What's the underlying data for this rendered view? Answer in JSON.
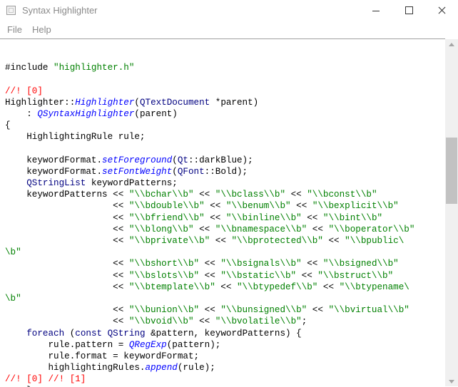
{
  "window": {
    "title": "Syntax Highlighter",
    "colors": {
      "keyword": "#000080",
      "class": "#000080",
      "string": "#008000",
      "function": "#0000ff",
      "comment": "#ff0000"
    }
  },
  "menu": {
    "file": "File",
    "help": "Help"
  },
  "code": {
    "lines": [
      [],
      [
        {
          "t": "#include ",
          "c": ""
        },
        {
          "t": "\"highlighter.h\"",
          "c": "str"
        }
      ],
      [],
      [
        {
          "t": "//! [0]",
          "c": "cmt"
        }
      ],
      [
        {
          "t": "Highlighter::",
          "c": ""
        },
        {
          "t": "Highlighter",
          "c": "fn"
        },
        {
          "t": "(",
          "c": ""
        },
        {
          "t": "QTextDocument",
          "c": "cls"
        },
        {
          "t": " *parent)",
          "c": ""
        }
      ],
      [
        {
          "t": "    : ",
          "c": ""
        },
        {
          "t": "QSyntaxHighlighter",
          "c": "fn"
        },
        {
          "t": "(parent)",
          "c": ""
        }
      ],
      [
        {
          "t": "{",
          "c": ""
        }
      ],
      [
        {
          "t": "    HighlightingRule rule;",
          "c": ""
        }
      ],
      [],
      [
        {
          "t": "    keywordFormat.",
          "c": ""
        },
        {
          "t": "setForeground",
          "c": "fn"
        },
        {
          "t": "(",
          "c": ""
        },
        {
          "t": "Qt",
          "c": "cls"
        },
        {
          "t": "::darkBlue);",
          "c": ""
        }
      ],
      [
        {
          "t": "    keywordFormat.",
          "c": ""
        },
        {
          "t": "setFontWeight",
          "c": "fn"
        },
        {
          "t": "(",
          "c": ""
        },
        {
          "t": "QFont",
          "c": "cls"
        },
        {
          "t": "::Bold);",
          "c": ""
        }
      ],
      [
        {
          "t": "    ",
          "c": ""
        },
        {
          "t": "QStringList",
          "c": "cls"
        },
        {
          "t": " keywordPatterns;",
          "c": ""
        }
      ],
      [
        {
          "t": "    keywordPatterns << ",
          "c": ""
        },
        {
          "t": "\"\\\\bchar\\\\b\"",
          "c": "str"
        },
        {
          "t": " << ",
          "c": ""
        },
        {
          "t": "\"\\\\bclass\\\\b\"",
          "c": "str"
        },
        {
          "t": " << ",
          "c": ""
        },
        {
          "t": "\"\\\\bconst\\\\b\"",
          "c": "str"
        }
      ],
      [
        {
          "t": "                    << ",
          "c": ""
        },
        {
          "t": "\"\\\\bdouble\\\\b\"",
          "c": "str"
        },
        {
          "t": " << ",
          "c": ""
        },
        {
          "t": "\"\\\\benum\\\\b\"",
          "c": "str"
        },
        {
          "t": " << ",
          "c": ""
        },
        {
          "t": "\"\\\\bexplicit\\\\b\"",
          "c": "str"
        }
      ],
      [
        {
          "t": "                    << ",
          "c": ""
        },
        {
          "t": "\"\\\\bfriend\\\\b\"",
          "c": "str"
        },
        {
          "t": " << ",
          "c": ""
        },
        {
          "t": "\"\\\\binline\\\\b\"",
          "c": "str"
        },
        {
          "t": " << ",
          "c": ""
        },
        {
          "t": "\"\\\\bint\\\\b\"",
          "c": "str"
        }
      ],
      [
        {
          "t": "                    << ",
          "c": ""
        },
        {
          "t": "\"\\\\blong\\\\b\"",
          "c": "str"
        },
        {
          "t": " << ",
          "c": ""
        },
        {
          "t": "\"\\\\bnamespace\\\\b\"",
          "c": "str"
        },
        {
          "t": " << ",
          "c": ""
        },
        {
          "t": "\"\\\\boperator\\\\b\"",
          "c": "str"
        }
      ],
      [
        {
          "t": "                    << ",
          "c": ""
        },
        {
          "t": "\"\\\\bprivate\\\\b\"",
          "c": "str"
        },
        {
          "t": " << ",
          "c": ""
        },
        {
          "t": "\"\\\\bprotected\\\\b\"",
          "c": "str"
        },
        {
          "t": " << ",
          "c": ""
        },
        {
          "t": "\"\\\\bpublic\\",
          "c": "str"
        }
      ],
      [
        {
          "t": "\\b\"",
          "c": "str"
        }
      ],
      [
        {
          "t": "                    << ",
          "c": ""
        },
        {
          "t": "\"\\\\bshort\\\\b\"",
          "c": "str"
        },
        {
          "t": " << ",
          "c": ""
        },
        {
          "t": "\"\\\\bsignals\\\\b\"",
          "c": "str"
        },
        {
          "t": " << ",
          "c": ""
        },
        {
          "t": "\"\\\\bsigned\\\\b\"",
          "c": "str"
        }
      ],
      [
        {
          "t": "                    << ",
          "c": ""
        },
        {
          "t": "\"\\\\bslots\\\\b\"",
          "c": "str"
        },
        {
          "t": " << ",
          "c": ""
        },
        {
          "t": "\"\\\\bstatic\\\\b\"",
          "c": "str"
        },
        {
          "t": " << ",
          "c": ""
        },
        {
          "t": "\"\\\\bstruct\\\\b\"",
          "c": "str"
        }
      ],
      [
        {
          "t": "                    << ",
          "c": ""
        },
        {
          "t": "\"\\\\btemplate\\\\b\"",
          "c": "str"
        },
        {
          "t": " << ",
          "c": ""
        },
        {
          "t": "\"\\\\btypedef\\\\b\"",
          "c": "str"
        },
        {
          "t": " << ",
          "c": ""
        },
        {
          "t": "\"\\\\btypename\\",
          "c": "str"
        }
      ],
      [
        {
          "t": "\\b\"",
          "c": "str"
        }
      ],
      [
        {
          "t": "                    << ",
          "c": ""
        },
        {
          "t": "\"\\\\bunion\\\\b\"",
          "c": "str"
        },
        {
          "t": " << ",
          "c": ""
        },
        {
          "t": "\"\\\\bunsigned\\\\b\"",
          "c": "str"
        },
        {
          "t": " << ",
          "c": ""
        },
        {
          "t": "\"\\\\bvirtual\\\\b\"",
          "c": "str"
        }
      ],
      [
        {
          "t": "                    << ",
          "c": ""
        },
        {
          "t": "\"\\\\bvoid\\\\b\"",
          "c": "str"
        },
        {
          "t": " << ",
          "c": ""
        },
        {
          "t": "\"\\\\bvolatile\\\\b\"",
          "c": "str"
        },
        {
          "t": ";",
          "c": ""
        }
      ],
      [
        {
          "t": "    ",
          "c": ""
        },
        {
          "t": "foreach",
          "c": "kw"
        },
        {
          "t": " (",
          "c": ""
        },
        {
          "t": "const",
          "c": "kw"
        },
        {
          "t": " ",
          "c": ""
        },
        {
          "t": "QString",
          "c": "cls"
        },
        {
          "t": " &pattern, keywordPatterns) {",
          "c": ""
        }
      ],
      [
        {
          "t": "        rule.pattern = ",
          "c": ""
        },
        {
          "t": "QRegExp",
          "c": "fn"
        },
        {
          "t": "(pattern);",
          "c": ""
        }
      ],
      [
        {
          "t": "        rule.format = keywordFormat;",
          "c": ""
        }
      ],
      [
        {
          "t": "        highlightingRules.",
          "c": ""
        },
        {
          "t": "append",
          "c": "fn"
        },
        {
          "t": "(rule);",
          "c": ""
        }
      ],
      [
        {
          "t": "//! [0] //! [1]",
          "c": "cmt"
        }
      ],
      [
        {
          "t": "    }",
          "c": ""
        }
      ]
    ]
  }
}
